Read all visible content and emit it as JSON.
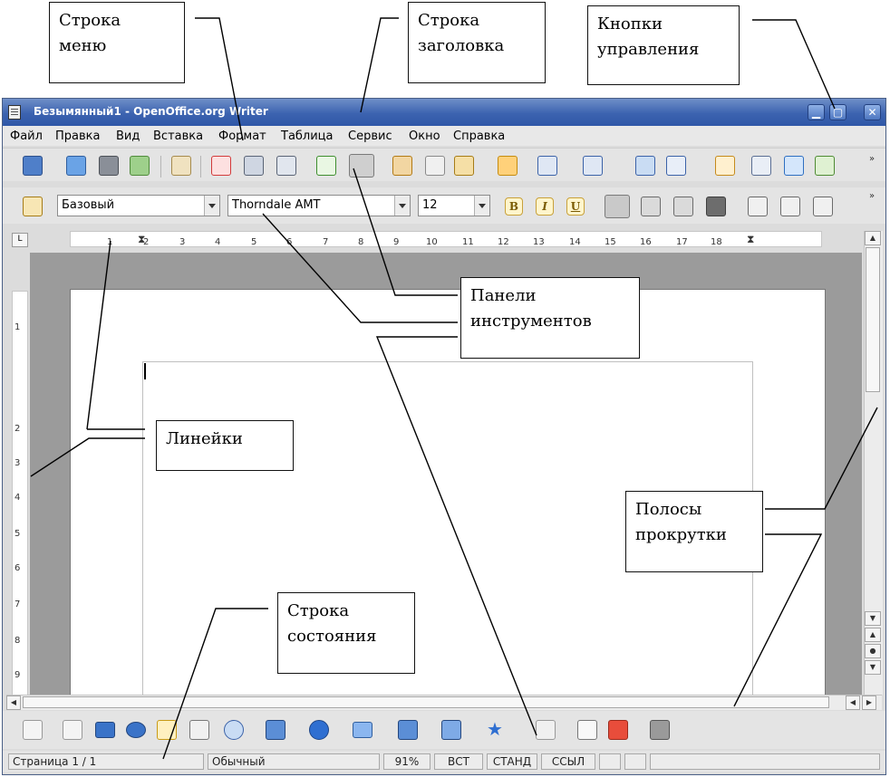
{
  "window": {
    "title": "Безымянный1 - OpenOffice.org Writer"
  },
  "menu": [
    "Файл",
    "Правка",
    "Вид",
    "Вставка",
    "Формат",
    "Таблица",
    "Сервис",
    "Окно",
    "Справка"
  ],
  "format_toolbar": {
    "style_value": "Базовый",
    "font_value": "Thorndale AMT",
    "size_value": "12",
    "bold": "B",
    "italic": "I",
    "underline": "U"
  },
  "ruler": {
    "h_labels": [
      "1",
      "2",
      "3",
      "4",
      "5",
      "6",
      "7",
      "8",
      "9",
      "10",
      "11",
      "12",
      "13",
      "14",
      "15",
      "16",
      "17",
      "18"
    ],
    "v_labels": [
      "1",
      "2",
      "3",
      "4",
      "5",
      "6",
      "7",
      "8",
      "9"
    ]
  },
  "statusbar": {
    "page": "Страница  1 / 1",
    "style": "Обычный",
    "zoom": "91%",
    "insert_mode": "ВСТ",
    "selection_mode": "СТАНД",
    "hyperlink_mode": "ССЫЛ"
  },
  "callouts": {
    "menu_bar": "Строка\nменю",
    "title_bar": "Строка\nзаголовка",
    "control_buttons": "Кнопки\nуправления",
    "toolbars": "Панели\nинструментов",
    "rulers": "Линейки",
    "scrollbars": "Полосы\nпрокрутки",
    "status_bar": "Строка\nсостояния"
  },
  "colors": {
    "titlebar": "#3c63b0",
    "page": "#ffffff",
    "doc_background": "#9b9b9b"
  }
}
